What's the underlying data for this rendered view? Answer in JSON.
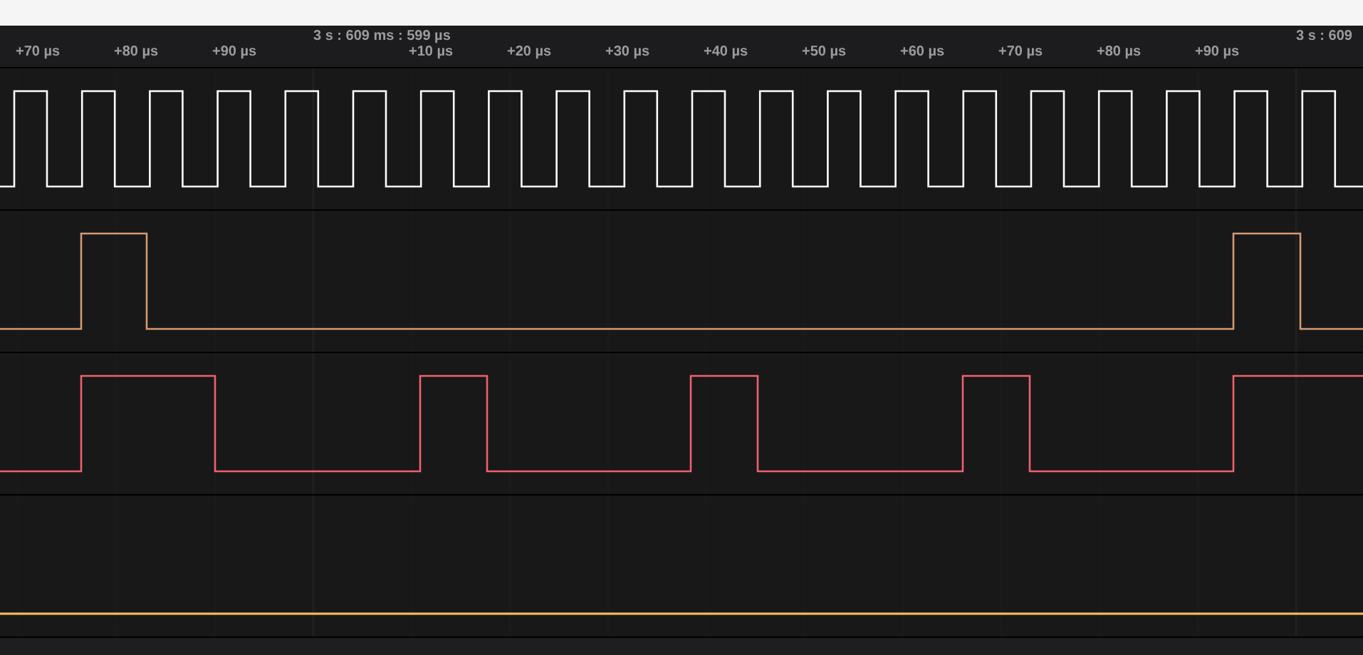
{
  "time_ruler": {
    "ticks": [
      {
        "kind": "minor",
        "label": "+70 µs"
      },
      {
        "kind": "minor",
        "label": "+80 µs"
      },
      {
        "kind": "minor",
        "label": "+90 µs"
      },
      {
        "kind": "major",
        "label": "3 s : 609 ms : 599 µs"
      },
      {
        "kind": "minor",
        "label": "+10 µs"
      },
      {
        "kind": "minor",
        "label": "+20 µs"
      },
      {
        "kind": "minor",
        "label": "+30 µs"
      },
      {
        "kind": "minor",
        "label": "+40 µs"
      },
      {
        "kind": "minor",
        "label": "+50 µs"
      },
      {
        "kind": "minor",
        "label": "+60 µs"
      },
      {
        "kind": "minor",
        "label": "+70 µs"
      },
      {
        "kind": "minor",
        "label": "+80 µs"
      },
      {
        "kind": "minor",
        "label": "+90 µs"
      },
      {
        "kind": "major",
        "label": "3 s : 609"
      }
    ]
  },
  "channels": [
    {
      "color": "#ffffff"
    },
    {
      "color": "#d49a72"
    },
    {
      "color": "#f0606e"
    },
    {
      "color": "#f2bc5a"
    }
  ]
}
